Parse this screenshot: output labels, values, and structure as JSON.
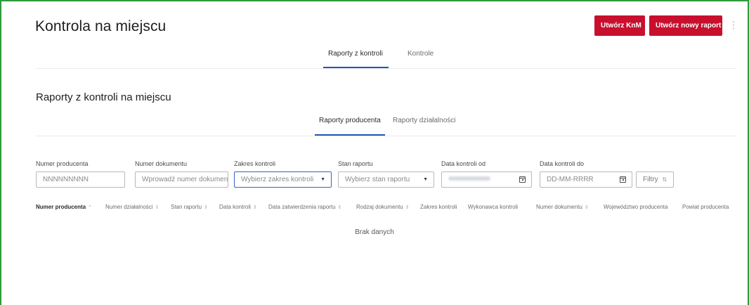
{
  "header": {
    "title": "Kontrola na miejscu",
    "btn_knm": "Utwórz KnM",
    "btn_new_report": "Utwórz nowy raport",
    "menu_icon": "more-vertical-icon",
    "menu_glyph": "⋮"
  },
  "main_tabs": [
    {
      "label": "Raporty z kontroli",
      "active": true
    },
    {
      "label": "Kontrole",
      "active": false
    }
  ],
  "section": {
    "title": "Raporty z kontroli na miejscu",
    "tabs": [
      {
        "label": "Raporty producenta",
        "active": true
      },
      {
        "label": "Raporty działalności",
        "active": false
      }
    ]
  },
  "filters": {
    "producer_number": {
      "label": "Numer producenta",
      "placeholder": "NNNNNNNNN"
    },
    "document_number": {
      "label": "Numer dokumentu",
      "placeholder": "Wprowadź numer dokumentu"
    },
    "control_scope": {
      "label": "Zakres kontroli",
      "placeholder": "Wybierz zakres kontroli"
    },
    "report_state": {
      "label": "Stan raportu",
      "placeholder": "Wybierz stan raportu"
    },
    "date_from": {
      "label": "Data kontroli od",
      "value": ""
    },
    "date_to": {
      "label": "Data kontroli do",
      "placeholder": "DD-MM-RRRR"
    },
    "more_filters": "Filtry"
  },
  "table": {
    "columns": [
      "Numer producenta",
      "Numer działalności",
      "Stan raportu",
      "Data kontroli",
      "Data zatwierdzenia raportu",
      "Rodzaj dokumentu",
      "Zakres kontroli",
      "Wykonawca kontroli",
      "Numer dokumentu",
      "Województwo producenta",
      "Powiat producenta"
    ],
    "empty_text": "Brak danych"
  },
  "colors": {
    "accent_red": "#c8102e",
    "accent_blue": "#2356b8",
    "frame_green": "#2f9a3c"
  }
}
